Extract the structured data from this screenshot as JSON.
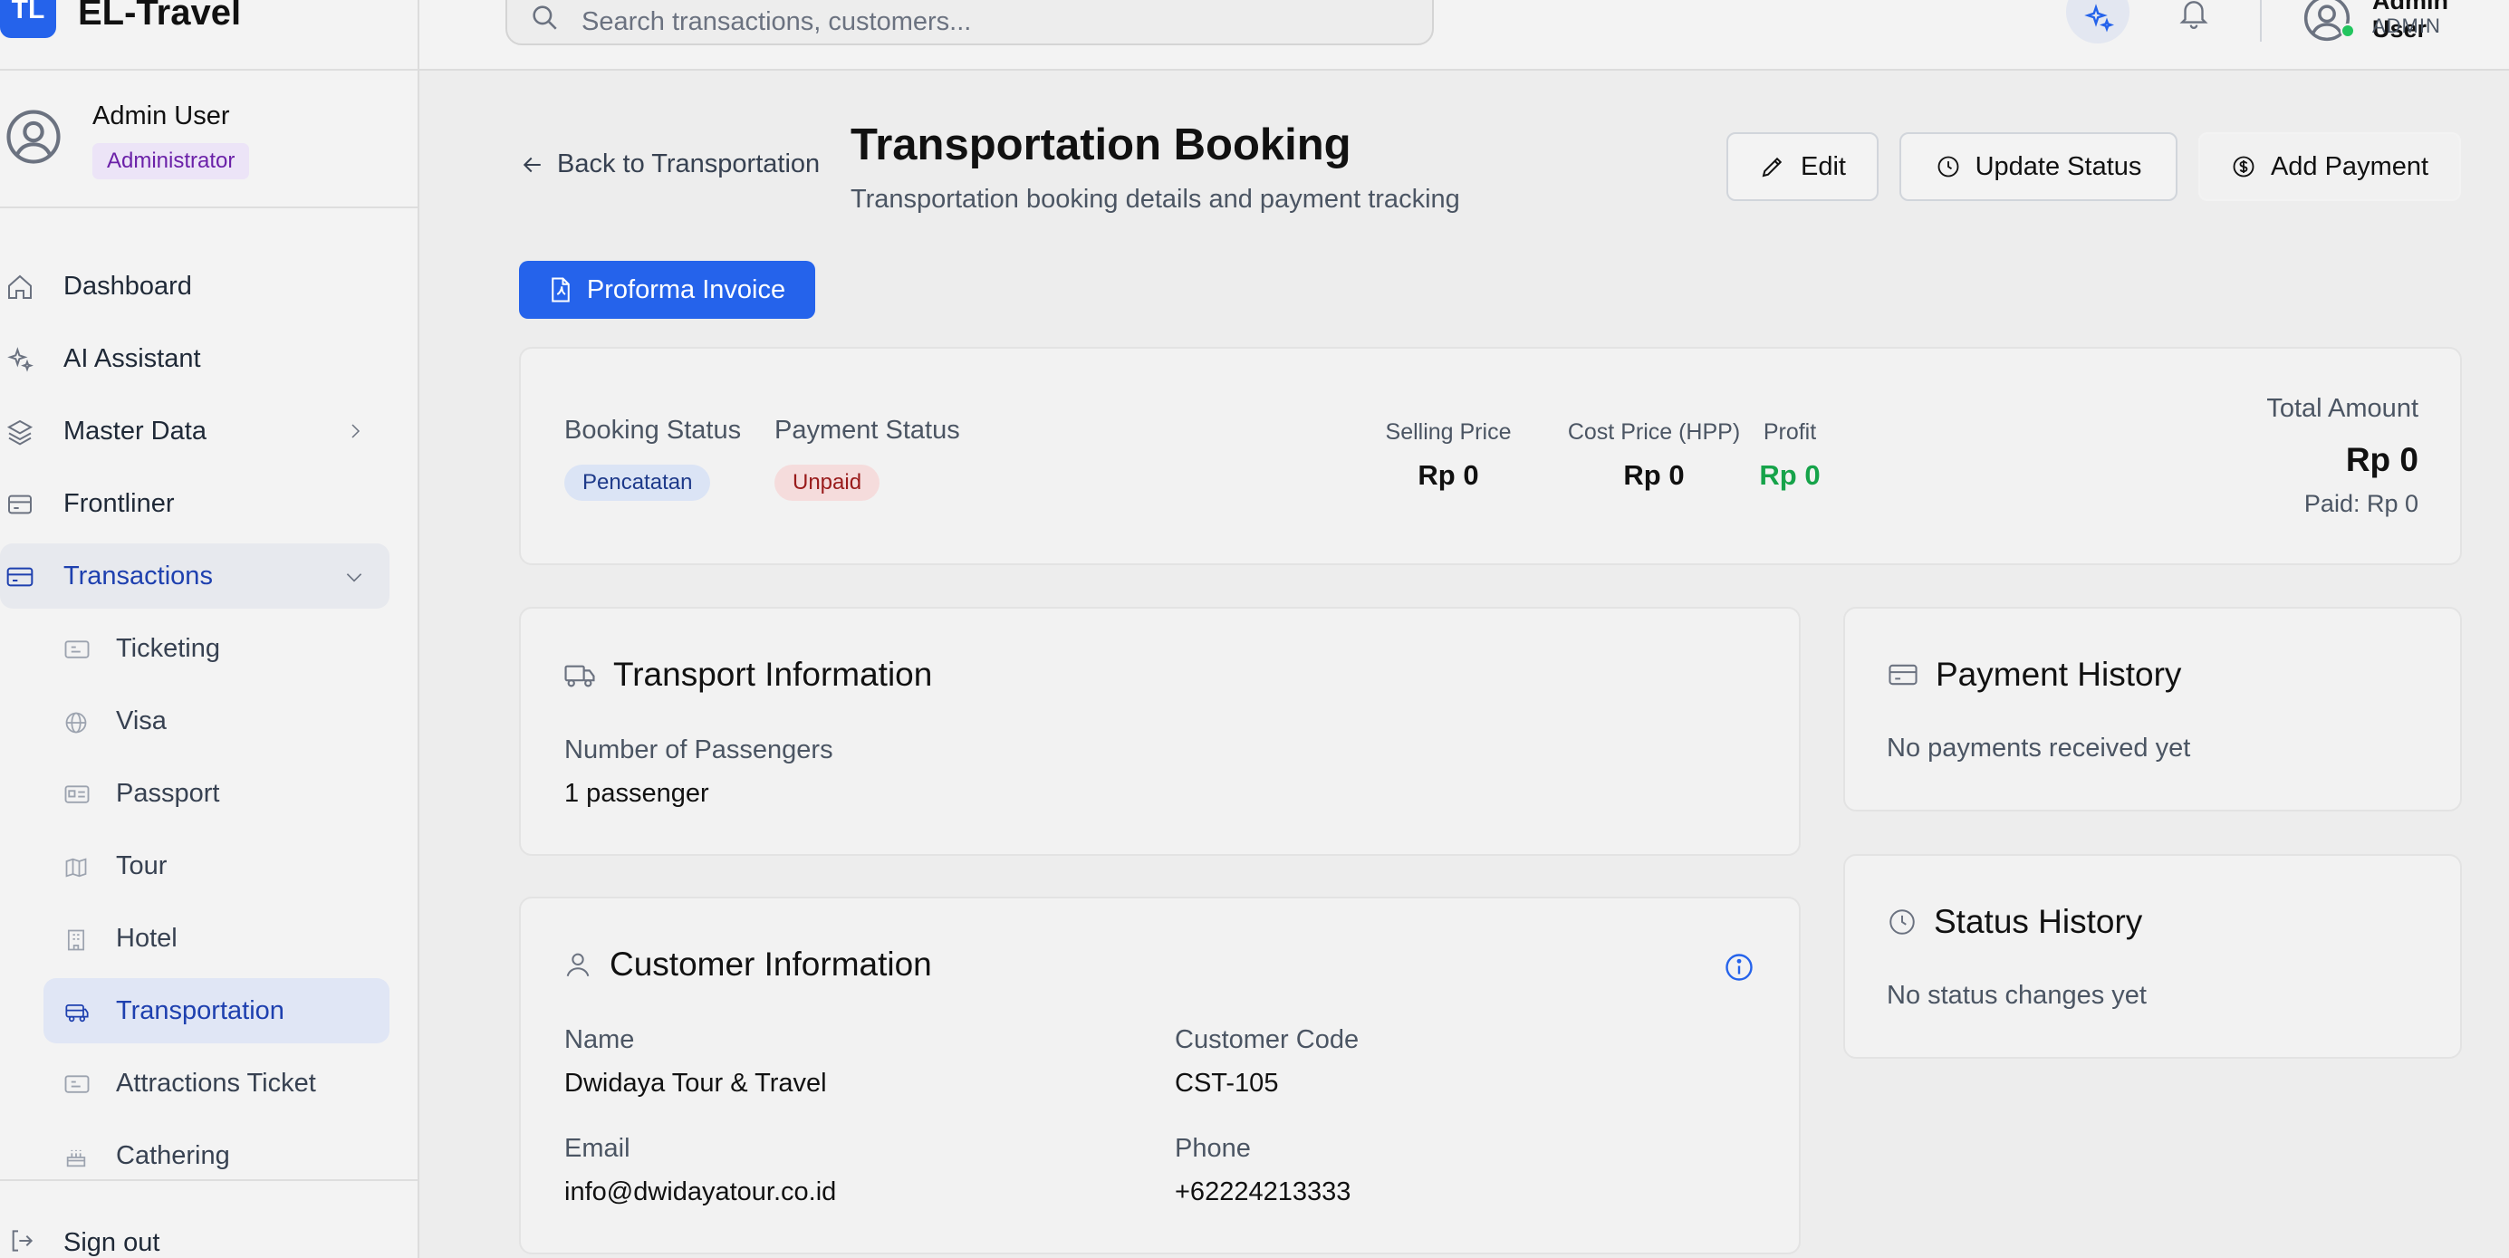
{
  "brand": {
    "logo": "TL",
    "name": "EL-Travel"
  },
  "profile": {
    "name": "Admin User",
    "role": "Administrator"
  },
  "nav": {
    "dashboard": "Dashboard",
    "ai_assistant": "AI Assistant",
    "master_data": "Master Data",
    "frontliner": "Frontliner",
    "transactions": "Transactions",
    "sub": {
      "ticketing": "Ticketing",
      "visa": "Visa",
      "passport": "Passport",
      "tour": "Tour",
      "hotel": "Hotel",
      "transportation": "Transportation",
      "attractions": "Attractions Ticket",
      "cathering": "Cathering"
    },
    "sign_out": "Sign out"
  },
  "topbar": {
    "search_placeholder": "Search transactions, customers...",
    "user_name": "Admin User",
    "user_role": "ADMIN"
  },
  "page": {
    "back": "Back to Transportation",
    "title": "Transportation Booking",
    "subtitle": "Transportation booking details and payment tracking",
    "edit": "Edit",
    "update_status": "Update Status",
    "add_payment": "Add Payment",
    "proforma": "Proforma Invoice"
  },
  "summary": {
    "booking_status_label": "Booking Status",
    "booking_status": "Pencatatan",
    "payment_status_label": "Payment Status",
    "payment_status": "Unpaid",
    "selling_price_label": "Selling Price",
    "selling_price": "Rp 0",
    "cost_price_label": "Cost Price (HPP)",
    "cost_price": "Rp 0",
    "profit_label": "Profit",
    "profit": "Rp 0",
    "total_label": "Total Amount",
    "total": "Rp 0",
    "paid": "Paid: Rp 0"
  },
  "transport": {
    "title": "Transport Information",
    "passengers_label": "Number of Passengers",
    "passengers": "1 passenger"
  },
  "customer": {
    "title": "Customer Information",
    "name_label": "Name",
    "name": "Dwidaya Tour & Travel",
    "code_label": "Customer Code",
    "code": "CST-105",
    "email_label": "Email",
    "email": "info@dwidayatour.co.id",
    "phone_label": "Phone",
    "phone": "+62224213333"
  },
  "payment_history": {
    "title": "Payment History",
    "empty": "No payments received yet"
  },
  "status_history": {
    "title": "Status History",
    "empty": "No status changes yet"
  },
  "colors": {
    "primary": "#2563eb",
    "profit": "#16a34a",
    "unpaid_bg": "#f5dcdc",
    "pencatatan_bg": "#dbe4f5",
    "online": "#22c55e"
  }
}
